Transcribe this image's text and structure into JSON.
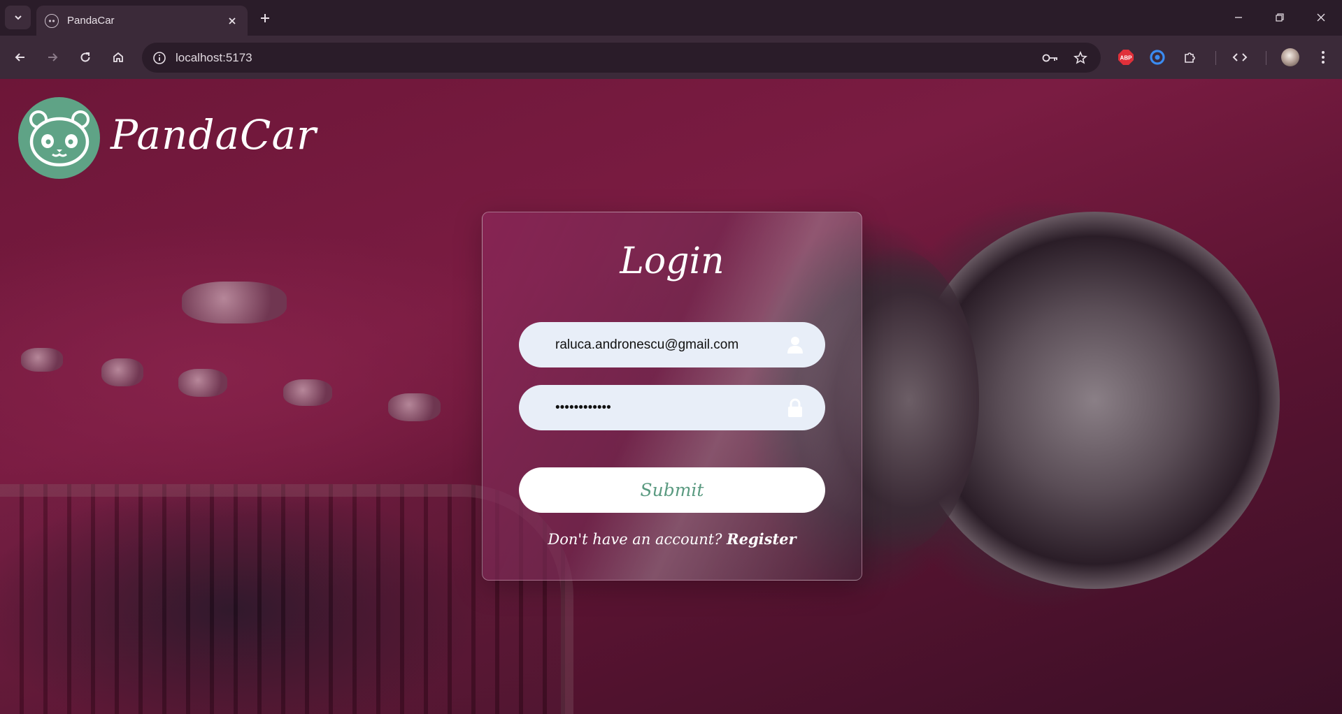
{
  "browser": {
    "tab": {
      "title": "PandaCar",
      "favicon": "panda-favicon"
    },
    "url": "localhost:5173",
    "icons": {
      "tab_search": "chevron-down-icon",
      "close_tab": "close-icon",
      "new_tab": "plus-icon",
      "back": "arrow-left-icon",
      "forward": "arrow-right-icon",
      "reload": "reload-icon",
      "home": "home-icon",
      "site_info": "info-icon",
      "password": "key-icon",
      "bookmark": "star-icon",
      "menu": "kebab-menu-icon"
    },
    "extensions": {
      "adblock_label": "ABP"
    }
  },
  "app": {
    "brand": "PandaCar",
    "colors": {
      "brand_green": "#5fa386",
      "field_bg": "#e8eef8",
      "submit_text": "#5a9a80"
    }
  },
  "login": {
    "title": "Login",
    "email_value": "raluca.andronescu@gmail.com",
    "password_value": "••••••••••••",
    "submit_label": "Submit",
    "register_prompt": "Don't have an account?",
    "register_link": "Register"
  }
}
